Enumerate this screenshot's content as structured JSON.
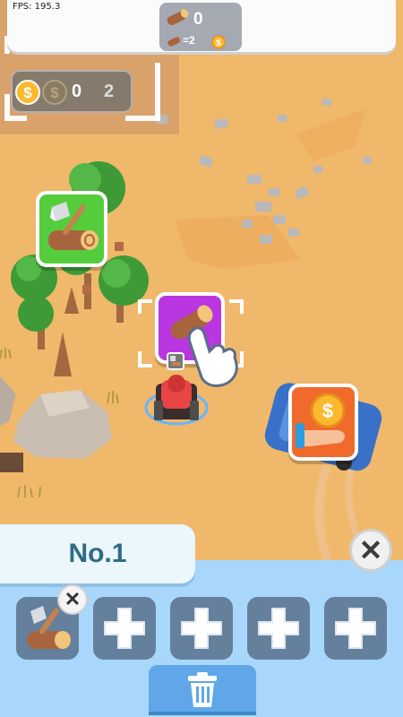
{
  "hud": {
    "fps": "FPS: 195.3",
    "wood_count": "0",
    "wood_rate": "=2",
    "coins": "0",
    "coin_target": "2"
  },
  "panel": {
    "rank_label": "No.1",
    "slots": [
      {
        "state": "lumberjack"
      },
      {
        "state": "empty"
      },
      {
        "state": "empty"
      },
      {
        "state": "empty"
      },
      {
        "state": "empty"
      }
    ]
  },
  "colors": {
    "sand": "#f0b86a",
    "lumber_station": "#55cc3c",
    "wood_station": "#b936e0",
    "sell_station": "#f06a2c",
    "panel": "#a8d7fb",
    "slot": "#64809c",
    "trash_button": "#5fa7e8"
  }
}
